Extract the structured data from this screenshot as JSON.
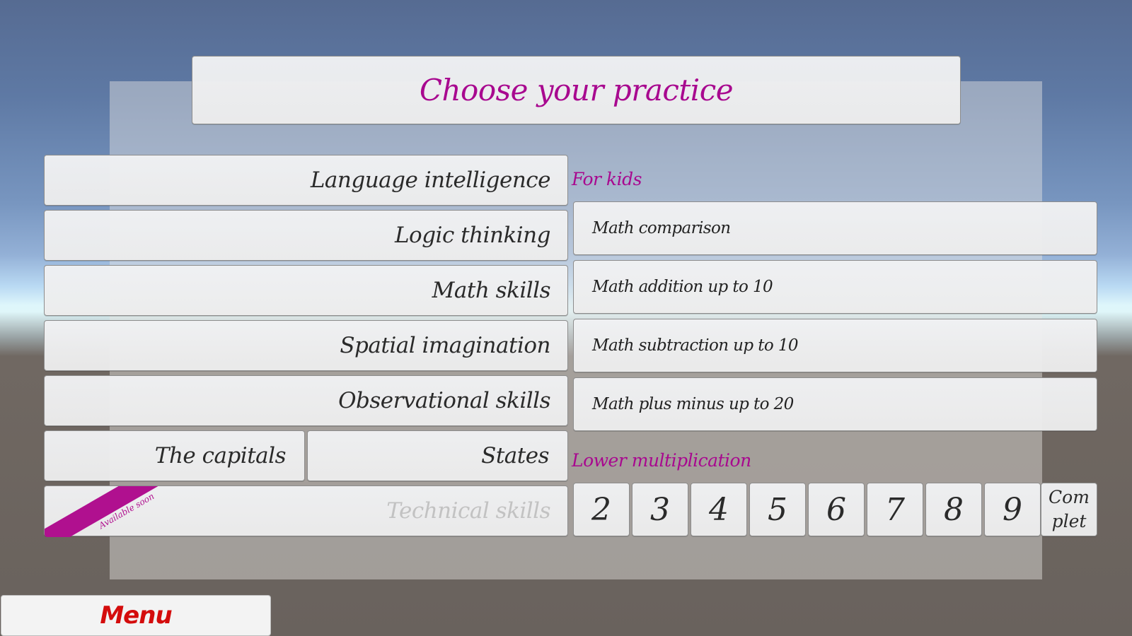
{
  "header": {
    "title": "Choose your practice"
  },
  "categories": [
    {
      "label": "Language intelligence",
      "enabled": true
    },
    {
      "label": "Logic thinking",
      "enabled": true
    },
    {
      "label": "Math skills",
      "enabled": true
    },
    {
      "label": "Spatial imagination",
      "enabled": true
    },
    {
      "label": "Observational skills",
      "enabled": true
    }
  ],
  "geography": {
    "capitals_label": "The capitals",
    "states_label": "States"
  },
  "technical": {
    "label": "Technical skills",
    "badge": "Available soon",
    "enabled": false
  },
  "for_kids": {
    "heading": "For kids",
    "items": [
      {
        "label": "Math comparison"
      },
      {
        "label": "Math addition up to 10"
      },
      {
        "label": "Math subtraction up to 10"
      },
      {
        "label": "Math plus minus up to 20"
      }
    ]
  },
  "multiplication": {
    "heading": "Lower multiplication",
    "numbers": [
      "2",
      "3",
      "4",
      "5",
      "6",
      "7",
      "8",
      "9"
    ],
    "complete_label": "Complet"
  },
  "footer": {
    "menu_label": "Menu"
  },
  "colors": {
    "accent": "#a8088f",
    "menu_text": "#d40c0c",
    "disabled_text": "#c2c2c2"
  }
}
